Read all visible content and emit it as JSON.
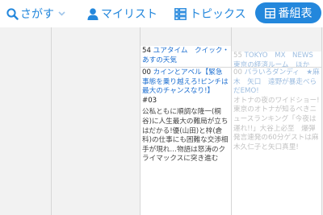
{
  "nav": {
    "search_label": "さがす",
    "mylist_label": "マイリスト",
    "topics_label": "トピックス",
    "guide_label": "番組表"
  },
  "colors": {
    "accent": "#2387dc",
    "title_link": "#1d6fd1",
    "grid_bg": "#f2f2f2"
  },
  "icons": {
    "search": "search-icon",
    "dropdown": "chevron-down-icon",
    "mylist": "person-icon",
    "topics": "list-icon",
    "guide": "grid-icon"
  },
  "programs": {
    "p1": {
      "minute": "54",
      "title": "ユアタイム　クイック・あすの天気"
    },
    "p2": {
      "minute": "00",
      "title": "カインとアベル【緊急事態を乗り越えろ!ピンチは最大のチャンスなり!】",
      "badge": "#03",
      "desc": "公私ともに順調な隆一(桐谷)に人生最大の難局が立ちはだかる!優(山田)と梓(倉科)の仕事にも困難な交渉相手が現れ…物語は怒涛のクライマックスに突き進む"
    },
    "p3": {
      "minute": "55",
      "title": "TOKYO　MX　NEWS　東京の経済ルーム　ほか"
    },
    "p4": {
      "minute": "00",
      "title": "バラいろダンディ　★麻木　矢口　遠野が暴走べらだEMO!",
      "desc": "オトナの夜のワイドショー!東京のオトナが知るべきニュースランキング「今夜は運れ!!」大谷上必至　爆弾発言連発の60分ゲストは麻木久仁子と矢口真里!"
    }
  }
}
